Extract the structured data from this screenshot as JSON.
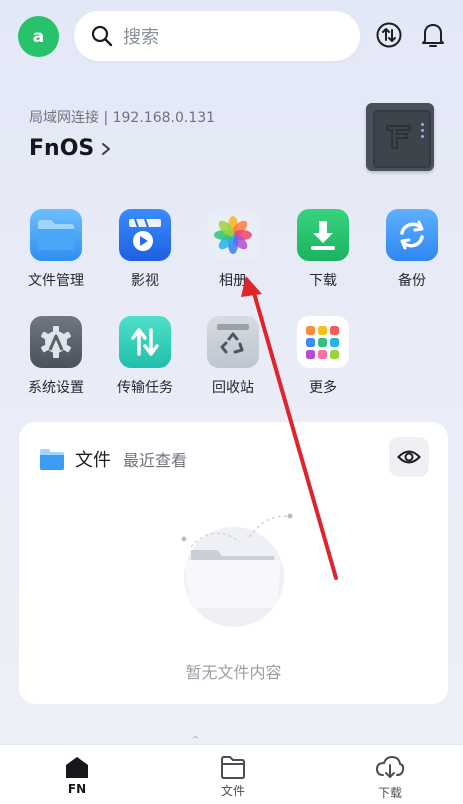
{
  "header": {
    "avatar_letter": "a",
    "search_placeholder": "搜索",
    "transfer_icon": "transfer-icon",
    "bell_icon": "bell-icon"
  },
  "device": {
    "connection": "局域网连接 | 192.168.0.131",
    "name": "FnOS",
    "chevron": "›"
  },
  "apps": [
    {
      "label": "文件管理",
      "icon": "folder-icon"
    },
    {
      "label": "影视",
      "icon": "video-icon"
    },
    {
      "label": "相册",
      "icon": "photos-icon"
    },
    {
      "label": "下载",
      "icon": "download-icon"
    },
    {
      "label": "备份",
      "icon": "backup-icon"
    },
    {
      "label": "系统设置",
      "icon": "settings-icon"
    },
    {
      "label": "传输任务",
      "icon": "transfer-task-icon"
    },
    {
      "label": "回收站",
      "icon": "recycle-icon"
    },
    {
      "label": "更多",
      "icon": "more-icon"
    }
  ],
  "files_card": {
    "title": "文件",
    "subtitle": "最近查看",
    "empty_text": "暂无文件内容"
  },
  "bottom_nav": [
    {
      "label": "FN",
      "icon": "home-icon",
      "active": true
    },
    {
      "label": "文件",
      "icon": "folder-outline-icon",
      "active": false
    },
    {
      "label": "下载",
      "icon": "download-cloud-icon",
      "active": false
    }
  ],
  "colors": {
    "accent_green": "#27c26b",
    "annotation_arrow": "#e0242b"
  }
}
